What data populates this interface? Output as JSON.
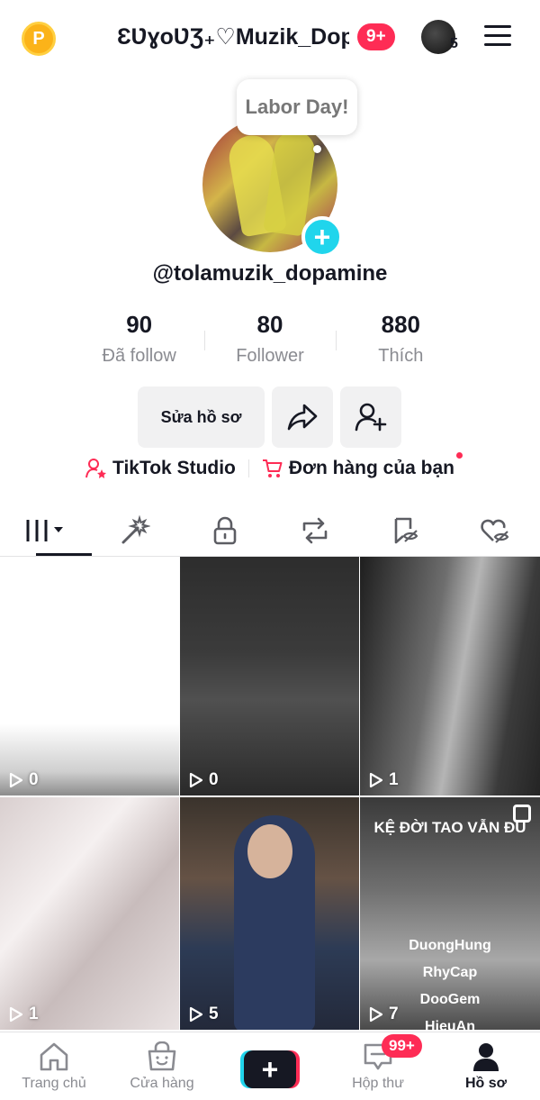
{
  "header": {
    "coin_symbol": "P",
    "username": "ƐƲɣoƲƷ₊♡Muzik_Dop...",
    "notification_badge": "9+",
    "story_count": "5"
  },
  "profile": {
    "bubble_text": "Labor Day!",
    "add_symbol": "+",
    "handle": "@tolamuzik_dopamine",
    "stats": [
      {
        "value": "90",
        "label": "Đã follow"
      },
      {
        "value": "80",
        "label": "Follower"
      },
      {
        "value": "880",
        "label": "Thích"
      }
    ],
    "edit_button": "Sửa hồ sơ",
    "studio_link": "TikTok Studio",
    "orders_link": "Đơn hàng của bạn"
  },
  "videos": [
    {
      "views": "0"
    },
    {
      "views": "0"
    },
    {
      "views": "1"
    },
    {
      "views": "1"
    },
    {
      "views": "5"
    },
    {
      "views": "7",
      "title": "KỆ ĐỜI TAO VẪN ĐU",
      "names": [
        "DuongHung",
        "RhyCap",
        "DooGem",
        "HieuAn"
      ]
    }
  ],
  "bottom_nav": {
    "home": "Trang chủ",
    "shop": "Cửa hàng",
    "create": "+",
    "inbox": "Hộp thư",
    "inbox_badge": "99+",
    "profile": "Hồ sơ"
  },
  "colors": {
    "accent_red": "#fe2c55",
    "accent_cyan": "#20d5ec",
    "text_primary": "#161823",
    "text_secondary": "#8a8b91"
  }
}
